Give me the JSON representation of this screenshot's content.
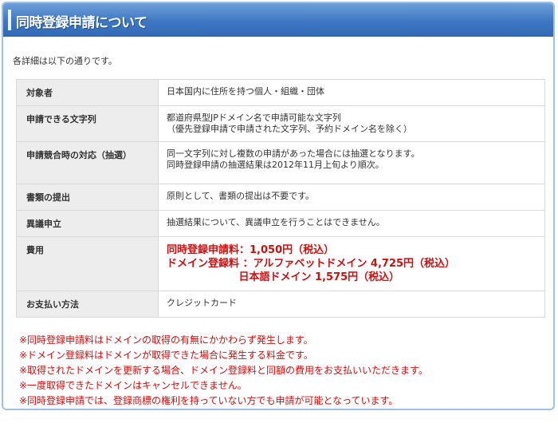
{
  "header": {
    "title": "同時登録申請について"
  },
  "intro": "各詳細は以下の通りです。",
  "rows": [
    {
      "label": "対象者",
      "lines": [
        "日本国内に住所を持つ個人・組織・団体"
      ]
    },
    {
      "label": "申請できる文字列",
      "lines": [
        "都道府県型JPドメイン名で申請可能な文字列",
        "（優先登録申請で申請された文字列、予約ドメイン名を除く）"
      ]
    },
    {
      "label": "申請競合時の対応（抽選）",
      "lines": [
        "同一文字列に対し複数の申請があった場合には抽選となります。",
        "同時登録申請の抽選結果は2012年11月上旬より順次。"
      ]
    },
    {
      "label": "書類の提出",
      "lines": [
        "原則として、書類の提出は不要です。"
      ]
    },
    {
      "label": "異議申立",
      "lines": [
        "抽選結果について、異議申立を行うことはできません。"
      ]
    },
    {
      "label": "費用",
      "fees": [
        "同時登録申請料：1,050円（税込）",
        "ドメイン登録料 ：アルファベットドメイン 4,725円（税込）",
        "                    日本語ドメイン 1,575円（税込）"
      ]
    },
    {
      "label": "お支払い方法",
      "lines": [
        "クレジットカード"
      ]
    }
  ],
  "notes": [
    "※同時登録申請料はドメインの取得の有無にかかわらず発生します。",
    "※ドメイン登録料はドメインが取得できた場合に発生する料金です。",
    "※取得されたドメインを更新する場合、ドメイン登録料と同額の費用をお支払いいただきます。",
    "※一度取得できたドメインはキャンセルできません。",
    "※同時登録申請では、登録商標の権利を持っていない方でも申請が可能となっています。"
  ]
}
